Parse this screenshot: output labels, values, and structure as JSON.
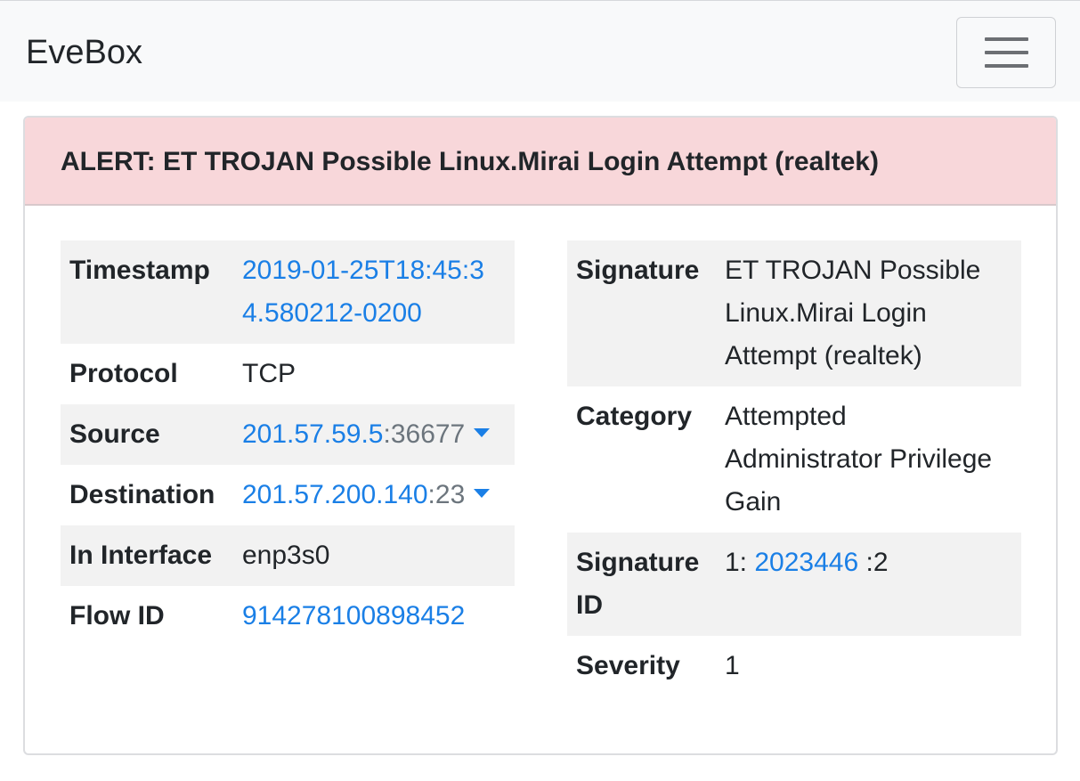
{
  "navbar": {
    "brand": "EveBox",
    "menu_icon": "hamburger-menu-icon"
  },
  "alert": {
    "title": "ALERT: ET TROJAN Possible Linux.Mirai Login Attempt (realtek)",
    "header_color": "#f8d7da"
  },
  "left_table": {
    "timestamp": {
      "key": "Timestamp",
      "line1": "2019-01-25T18:45:3",
      "line2": "4.580212-0200"
    },
    "protocol": {
      "key": "Protocol",
      "value": "TCP"
    },
    "source": {
      "key": "Source",
      "ip": "201.57.59.5",
      "port": ":36677",
      "icon": "caret-down-icon"
    },
    "destination": {
      "key": "Destination",
      "ip": "201.57.200.140",
      "port": ":23",
      "icon": "caret-down-icon"
    },
    "in_interface": {
      "key": "In Interface",
      "value": "enp3s0"
    },
    "flow_id": {
      "key": "Flow ID",
      "value": "914278100898452"
    }
  },
  "right_table": {
    "signature": {
      "key": "Signature",
      "lines": [
        "ET TROJAN Possible",
        "Linux.Mirai Login",
        "Attempt (realtek)"
      ]
    },
    "category": {
      "key": "Category",
      "lines": [
        "Attempted",
        "Administrator Privilege",
        "Gain"
      ]
    },
    "signature_id": {
      "key_line1": "Signature",
      "key_line2": "ID",
      "prefix": "1: ",
      "sid": "2023446",
      "suffix": " :2"
    },
    "severity": {
      "key": "Severity",
      "value": "1"
    }
  },
  "colors": {
    "link": "#1a7fe6",
    "muted": "#6c757d",
    "stripe": "#f2f2f2"
  }
}
